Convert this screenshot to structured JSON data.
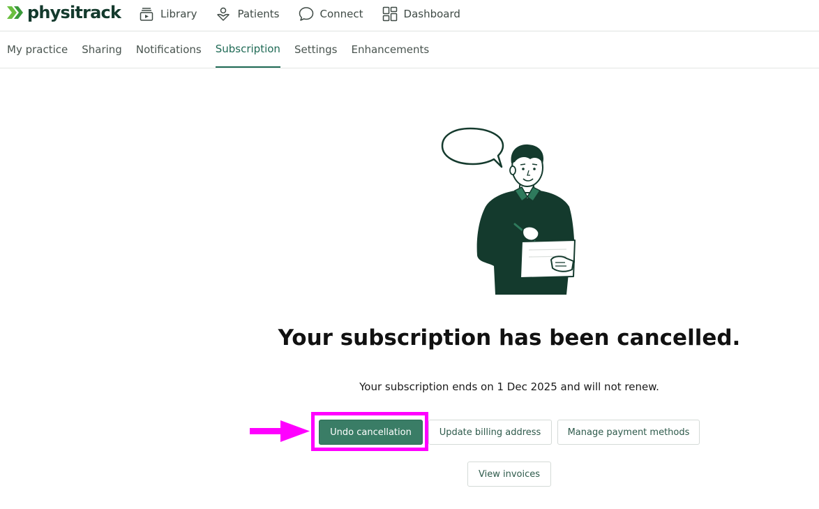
{
  "app": {
    "logo_text": "physitrack",
    "brand_color": "#143a2d",
    "accent_color": "#3a7d66",
    "logo_chevron_color": "#6abf3f"
  },
  "main_nav": {
    "items": [
      {
        "label": "Library",
        "icon": "library-icon"
      },
      {
        "label": "Patients",
        "icon": "patients-icon"
      },
      {
        "label": "Connect",
        "icon": "chat-bubble-icon"
      },
      {
        "label": "Dashboard",
        "icon": "dashboard-icon"
      }
    ]
  },
  "sub_nav": {
    "tabs": [
      {
        "label": "My practice",
        "active": false
      },
      {
        "label": "Sharing",
        "active": false
      },
      {
        "label": "Notifications",
        "active": false
      },
      {
        "label": "Subscription",
        "active": true
      },
      {
        "label": "Settings",
        "active": false
      },
      {
        "label": "Enhancements",
        "active": false
      }
    ]
  },
  "content": {
    "headline": "Your subscription has been cancelled.",
    "subtext": "Your subscription ends on 1 Dec 2025 and will not renew.",
    "buttons": {
      "undo": "Undo cancellation",
      "billing": "Update billing address",
      "payment": "Manage payment methods",
      "invoices": "View invoices"
    }
  },
  "annotation": {
    "highlight_color": "#ff00ff"
  }
}
